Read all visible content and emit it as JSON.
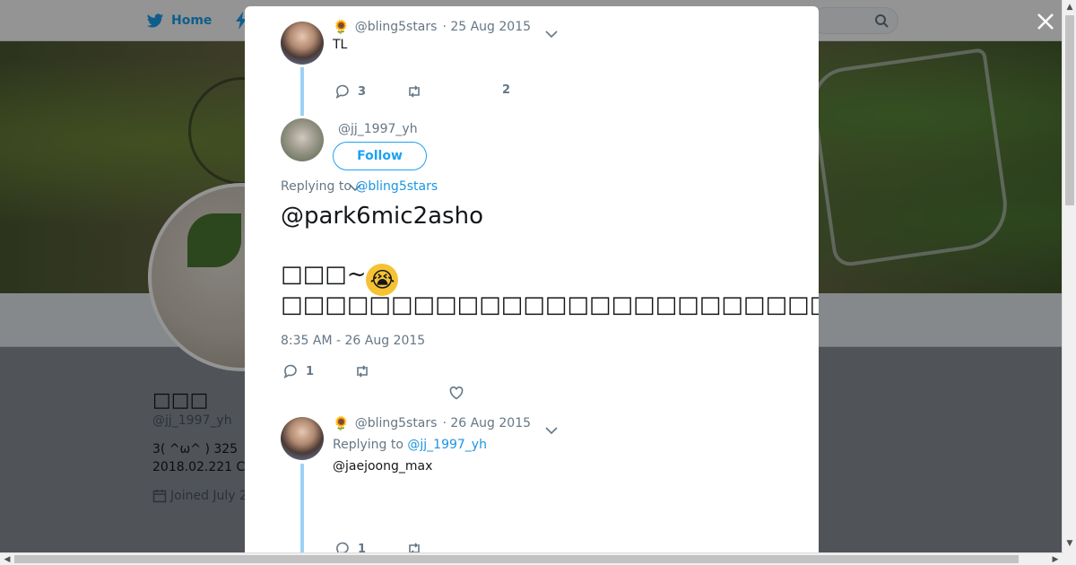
{
  "nav": {
    "home_label": "Home"
  },
  "profile": {
    "name": "□□□",
    "handle": "@jj_1997_yh",
    "bio_line1": "3( ^ω^ ) 325",
    "bio_line2": "2018.02.221 C",
    "joined": "Joined July 2"
  },
  "thread": {
    "tweet1": {
      "badge": "🌻",
      "handle": "@bling5stars",
      "date": "· 25 Aug 2015",
      "text": "TL",
      "reply_count": "3",
      "like_count": "2"
    },
    "main": {
      "handle": "@jj_1997_yh",
      "follow_label": "Follow",
      "replying_prefix": "Replying to",
      "replying_handle": "@bling5stars",
      "mention": "@park6mic2asho",
      "line1_text": "□□□~",
      "line1_emoji": "😭",
      "line2_a": "□□□□□□□□□□□□□□□□□□□□□□□□□□□□□□",
      "line2_emoji": "😣",
      "line2_b": "□□□□□□□□□□□□□□□□□□□□□□□□□□□□",
      "timestamp": "8:35 AM - 26 Aug 2015",
      "reply_count": "1"
    },
    "tweet3": {
      "badge": "🌻",
      "handle": "@bling5stars",
      "date": "· 26 Aug 2015",
      "replying_prefix": "Replying to",
      "replying_handle": "@jj_1997_yh",
      "text": "@jaejoong_max",
      "reply_count": "1"
    }
  },
  "colors": {
    "accent": "#1da1f2",
    "thread_line": "#9cd3f5",
    "link": "#1b95e0"
  }
}
